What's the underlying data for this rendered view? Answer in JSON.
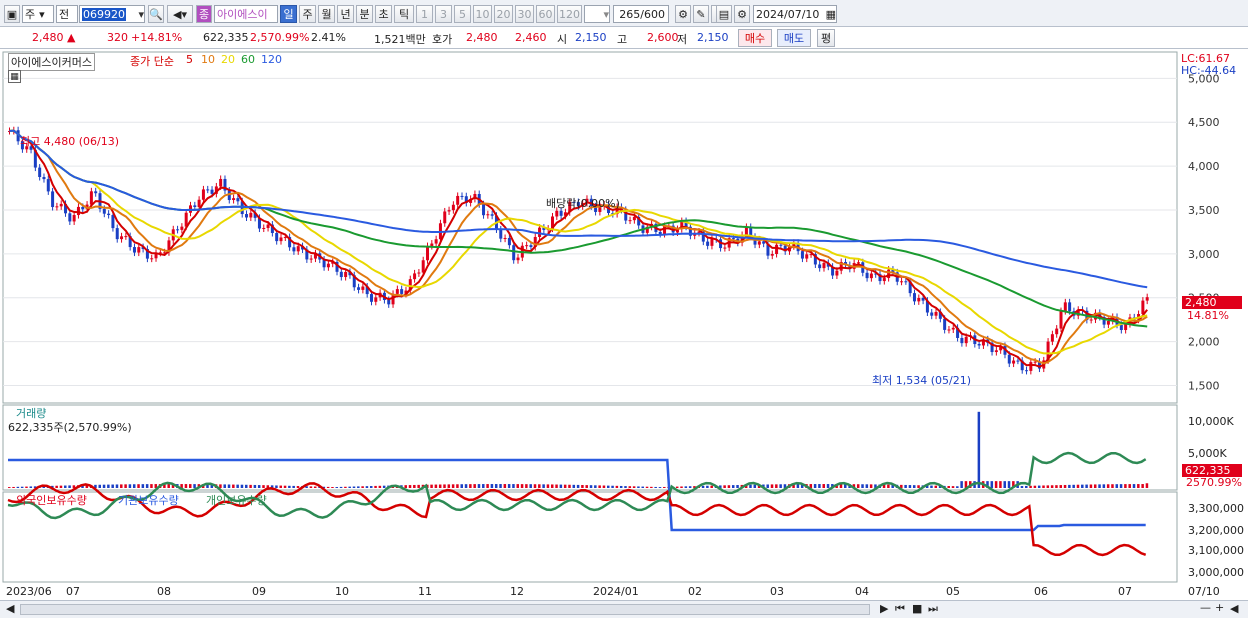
{
  "toolbar": {
    "market": "주",
    "type": "전",
    "code": "069920",
    "name": "아이에스이",
    "periods": [
      "일",
      "주",
      "월",
      "년",
      "분",
      "초",
      "틱"
    ],
    "active_period": "일",
    "minutes": [
      "1",
      "3",
      "5",
      "10",
      "20",
      "30",
      "60",
      "120"
    ],
    "count": "265/600",
    "date": "2024/07/10"
  },
  "price": {
    "close": "2,480",
    "change": "320",
    "change_pct": "+14.81%",
    "volume": "622,335",
    "volume_pct": "2,570.99%",
    "turnover": "2.41%",
    "amount": "1,521백만",
    "hoga_label": "호가",
    "ask": "2,480",
    "bid": "2,460",
    "open_label": "시",
    "open": "2,150",
    "high_label": "고",
    "high": "2,600",
    "low_label": "저",
    "low": "2,150",
    "buy_btn": "매수",
    "sell_btn": "매도",
    "eval_btn": "평"
  },
  "legend": {
    "stock": "아이에스이커머스",
    "ma_title": "종가 단순",
    "ma": [
      "5",
      "10",
      "20",
      "60",
      "120"
    ],
    "ma_colors": [
      "#d40000",
      "#e07a10",
      "#e8d800",
      "#1a9a30",
      "#2a5ae0"
    ]
  },
  "annotations": {
    "high": "최고 4,480 (06/13)",
    "low": "최저 1,534 (05/21)",
    "div": "배당락(0.00%)",
    "lc": "LC:61.67",
    "hc": "HC:-44.64",
    "last_price": "2,480",
    "last_pct": "14.81%"
  },
  "price_axis": [
    "5,000",
    "4,500",
    "4,000",
    "3,500",
    "3,000",
    "2,500",
    "2,000",
    "1,500"
  ],
  "volume": {
    "title": "거래량",
    "value": "622,335주(2,570.99%)",
    "axis": [
      "10,000K",
      "5,000K"
    ],
    "last": "622,335",
    "last_pct": "2570.99%"
  },
  "holdings": {
    "foreign": "외국인보유수량",
    "inst": "기관보유수량",
    "indiv": "개인보유수량",
    "axis": [
      "3,300,000",
      "3,200,000",
      "3,100,000",
      "3,000,000"
    ],
    "colors": [
      "#d40000",
      "#2a5ae0",
      "#2e8a55"
    ]
  },
  "time_axis": [
    "2023/06",
    "07",
    "08",
    "09",
    "10",
    "11",
    "12",
    "2024/01",
    "02",
    "03",
    "04",
    "05",
    "06",
    "07"
  ],
  "right_date": "07/10",
  "chart_data": {
    "type": "candlestick",
    "series": [
      {
        "name": "아이에스이커머스",
        "close": [
          4400,
          4150,
          3600,
          3400,
          3700,
          3250,
          3050,
          2950,
          3300,
          3650,
          3800,
          3500,
          3320,
          3150,
          3000,
          2900,
          2750,
          2520,
          2480,
          2650,
          3100,
          3600,
          3650,
          3350,
          2950,
          3200,
          3450,
          3600,
          3520,
          3480,
          3300,
          3270,
          3320,
          3150,
          3100,
          3250,
          3020,
          3100,
          2950,
          2800,
          2900,
          2720,
          2780,
          2500,
          2280,
          2050,
          2000,
          1900,
          1700,
          1750,
          2400,
          2300,
          2250,
          2170,
          2480
        ]
      },
      {
        "name": "5",
        "color": "#d40000"
      },
      {
        "name": "10",
        "color": "#e07a10"
      },
      {
        "name": "20",
        "color": "#e8d800"
      },
      {
        "name": "60",
        "color": "#1a9a30"
      },
      {
        "name": "120",
        "color": "#2a5ae0"
      }
    ],
    "x": [
      "2023/06",
      "07",
      "08",
      "09",
      "10",
      "11",
      "12",
      "2024/01",
      "02",
      "03",
      "04",
      "05",
      "06",
      "07"
    ],
    "ylim": [
      1300,
      5300
    ],
    "volume_max": 10500
  }
}
